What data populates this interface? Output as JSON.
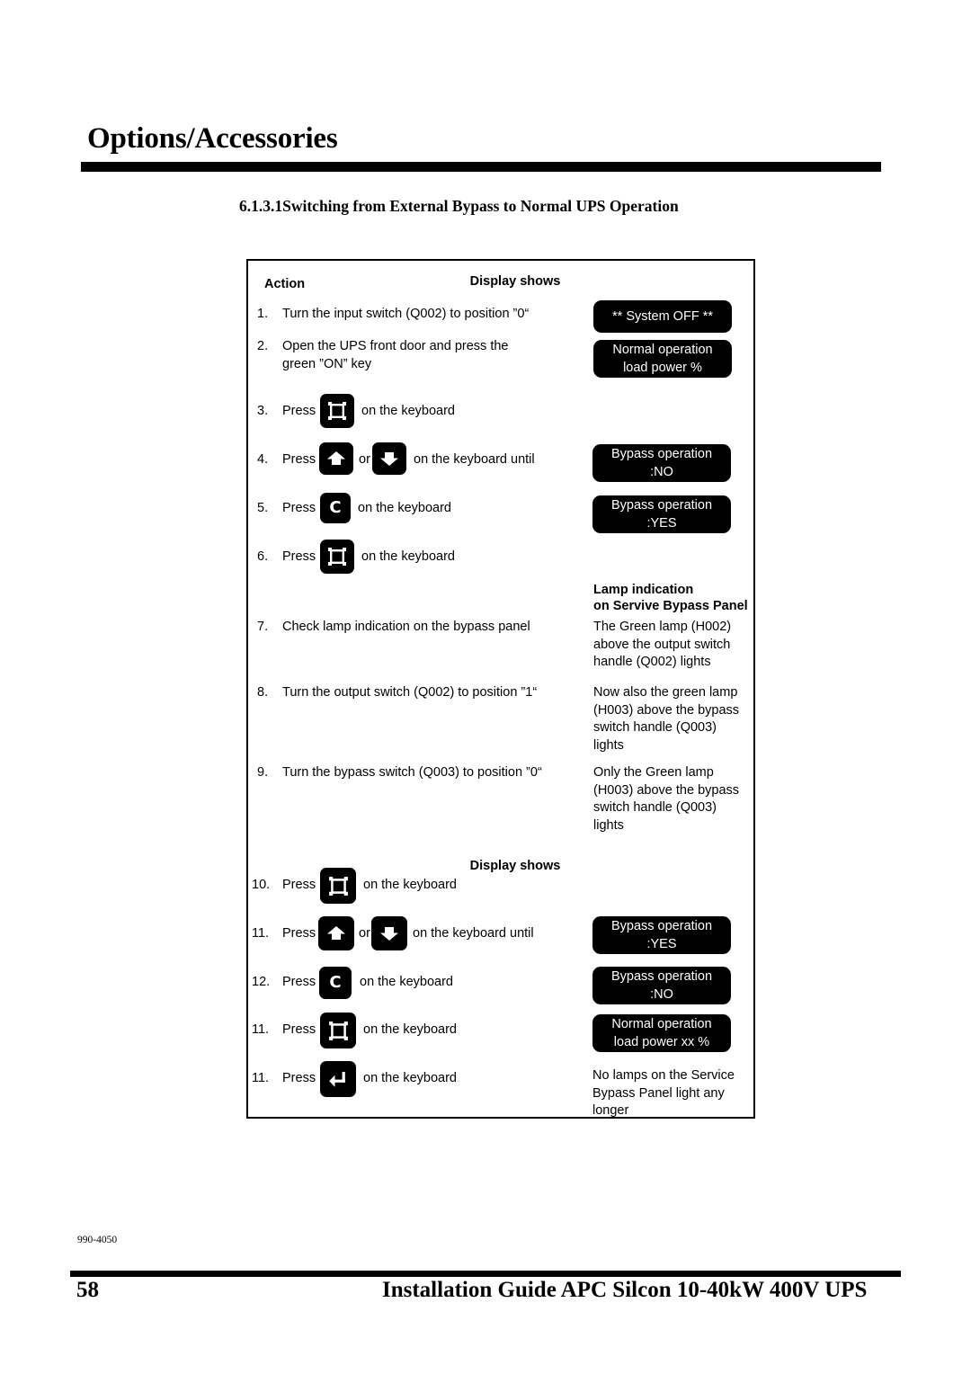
{
  "header": {
    "title": "Options/Accessories"
  },
  "section": {
    "heading": "6.1.3.1Switching from External Bypass to Normal UPS Operation"
  },
  "table": {
    "columns": {
      "action": "Action",
      "display_shows_top": "Display shows",
      "lamp_indication_line1": "Lamp indication",
      "lamp_indication_line2": "on Servive Bypass Panel",
      "display_shows_bottom": "Display shows"
    },
    "rows": [
      {
        "num": "1.",
        "text_before": "Turn the input switch (Q002) to position ”0“",
        "icon": null,
        "text_after": "",
        "display": {
          "kind": "lcd",
          "lines": [
            "** System OFF **"
          ]
        }
      },
      {
        "num": "2.",
        "text_before": "Open the UPS front door and press the",
        "text_line2": "green ”ON” key",
        "icon": null,
        "text_after": "",
        "display": {
          "kind": "lcd",
          "lines": [
            "Normal operation",
            "load power %"
          ]
        }
      },
      {
        "num": "3.",
        "text_before": "Press",
        "icon": "display-frame-key-icon",
        "text_after": "on the keyboard",
        "display": null
      },
      {
        "num": "4.",
        "text_before": "Press",
        "icon": "arrow-up-key-icon",
        "separator": "or",
        "icon2": "arrow-down-key-icon",
        "text_after": "on the keyboard until",
        "display": {
          "kind": "lcd",
          "lines": [
            "Bypass operation",
            ":NO"
          ]
        }
      },
      {
        "num": "5.",
        "text_before": "Press",
        "icon": "c-key-icon",
        "text_after": "on the keyboard",
        "display": {
          "kind": "lcd",
          "lines": [
            "Bypass operation",
            ":YES"
          ]
        }
      },
      {
        "num": "6.",
        "text_before": "Press",
        "icon": "display-frame-key-icon",
        "text_after": "on the keyboard",
        "display": null
      },
      {
        "num": "7.",
        "text_before": "Check lamp indication on the bypass panel",
        "icon": null,
        "text_after": "",
        "display": {
          "kind": "text",
          "lines": [
            "The Green lamp (H002)",
            "above the output switch",
            "handle (Q002) lights"
          ]
        }
      },
      {
        "num": "8.",
        "text_before": "Turn the output switch (Q002) to position ”1“",
        "icon": null,
        "text_after": "",
        "display": {
          "kind": "text",
          "lines": [
            "Now also the green lamp",
            "(H003) above the bypass",
            "switch handle (Q003)",
            "lights"
          ]
        }
      },
      {
        "num": "9.",
        "text_before": "Turn the bypass switch (Q003) to position ”0“",
        "icon": null,
        "text_after": "",
        "display": {
          "kind": "text",
          "lines": [
            "Only the Green lamp",
            "(H003) above the bypass",
            "switch handle (Q003)",
            "lights"
          ]
        }
      },
      {
        "num": "10.",
        "text_before": "Press",
        "icon": "display-frame-key-icon",
        "text_after": "on the keyboard",
        "display": null
      },
      {
        "num": "11.",
        "text_before": "Press",
        "icon": "arrow-up-key-icon",
        "separator": "or",
        "icon2": "arrow-down-key-icon",
        "text_after": "on the keyboard until",
        "display": {
          "kind": "lcd",
          "lines": [
            "Bypass operation",
            ":YES"
          ]
        }
      },
      {
        "num": "12.",
        "text_before": "Press",
        "icon": "c-key-icon",
        "text_after": "on the keyboard",
        "display": {
          "kind": "lcd",
          "lines": [
            "Bypass operation",
            ":NO"
          ]
        }
      },
      {
        "num": "11.",
        "text_before": "Press",
        "icon": "display-frame-key-icon",
        "text_after": "on the keyboard",
        "display": {
          "kind": "lcd",
          "lines": [
            "Normal operation",
            "load power xx %"
          ]
        }
      },
      {
        "num": "11.",
        "text_before": "Press",
        "icon": "enter-key-icon",
        "text_after": "on the keyboard",
        "display": {
          "kind": "text",
          "lines": [
            "No lamps on the Service",
            "Bypass Panel light any",
            "longer"
          ]
        }
      }
    ]
  },
  "footer": {
    "doc_code": "990-4050",
    "page_number": "58",
    "title": "Installation Guide APC Silcon 10-40kW 400V UPS"
  },
  "colors": {
    "ink": "#000000",
    "paper": "#ffffff",
    "lcd_background": "#000000",
    "lcd_text": "#ffffff"
  }
}
